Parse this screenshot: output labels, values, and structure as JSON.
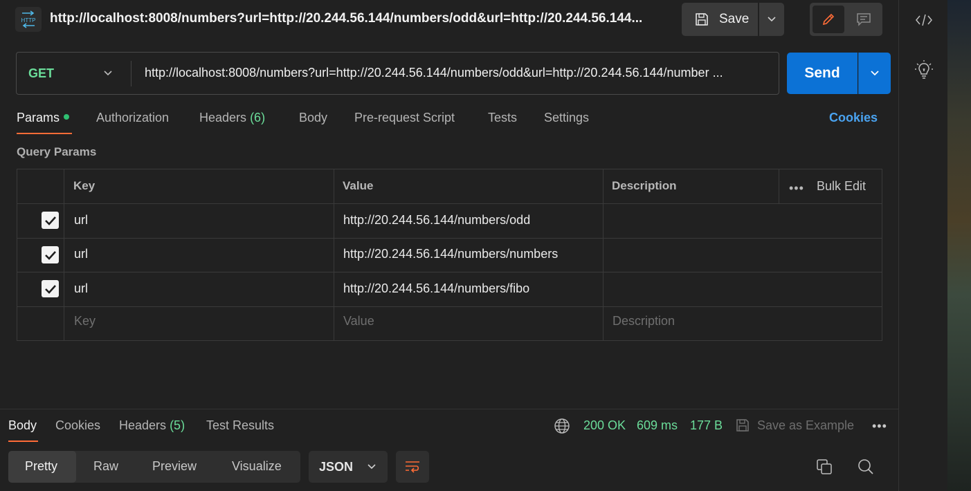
{
  "header": {
    "icon_text": "HTTP",
    "title": "http://localhost:8008/numbers?url=http://20.244.56.144/numbers/odd&url=http://20.244.56.144...",
    "save_label": "Save"
  },
  "request": {
    "method": "GET",
    "url": "http://localhost:8008/numbers?url=http://20.244.56.144/numbers/odd&url=http://20.244.56.144/number ...",
    "send_label": "Send"
  },
  "request_tabs": [
    {
      "label": "Params",
      "active": true
    },
    {
      "label": "Authorization"
    },
    {
      "label": "Headers",
      "count": "(6)"
    },
    {
      "label": "Body"
    },
    {
      "label": "Pre-request Script"
    },
    {
      "label": "Tests"
    },
    {
      "label": "Settings"
    }
  ],
  "cookies_link": "Cookies",
  "query_params": {
    "label": "Query Params",
    "headers": {
      "key": "Key",
      "value": "Value",
      "description": "Description",
      "bulk_edit": "Bulk Edit",
      "more": "•••"
    },
    "rows": [
      {
        "checked": true,
        "key": "url",
        "value": "http://20.244.56.144/numbers/odd",
        "description": ""
      },
      {
        "checked": true,
        "key": "url",
        "value": "http://20.244.56.144/numbers/numbers",
        "description": ""
      },
      {
        "checked": true,
        "key": "url",
        "value": "http://20.244.56.144/numbers/fibo",
        "description": ""
      }
    ],
    "placeholders": {
      "key": "Key",
      "value": "Value",
      "description": "Description"
    }
  },
  "response": {
    "tabs": [
      {
        "label": "Body",
        "active": true
      },
      {
        "label": "Cookies"
      },
      {
        "label": "Headers",
        "count": "(5)"
      },
      {
        "label": "Test Results"
      }
    ],
    "status": "200 OK",
    "time": "609 ms",
    "size": "177 B",
    "save_example": "Save as Example",
    "more": "•••",
    "views": [
      "Pretty",
      "Raw",
      "Preview",
      "Visualize"
    ],
    "format": "JSON"
  },
  "colors": {
    "accent_orange": "#ff6c37",
    "send_blue": "#0c72d6",
    "status_green": "#6bdd9a",
    "link_blue": "#4aa3f0"
  }
}
